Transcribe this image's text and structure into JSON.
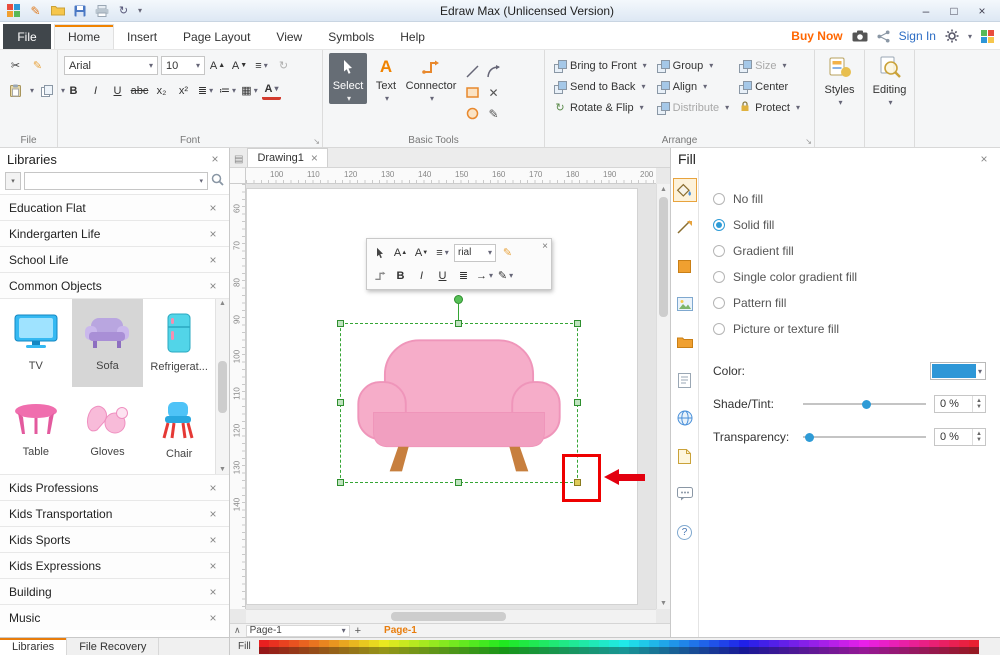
{
  "titlebar": {
    "title": "Edraw Max (Unlicensed Version)"
  },
  "menu": {
    "file": "File",
    "tabs": [
      "Home",
      "Insert",
      "Page Layout",
      "View",
      "Symbols",
      "Help"
    ],
    "buy_now": "Buy Now",
    "sign_in": "Sign In"
  },
  "ribbon": {
    "file_group": {
      "label": "File"
    },
    "font_group": {
      "label": "Font",
      "font_family": "Arial",
      "font_size": "10",
      "grow": "A",
      "shrink": "A",
      "bold": "B",
      "italic": "I",
      "underline": "U",
      "strike": "abc",
      "subscript": "x₂",
      "superscript": "x²",
      "color_letter": "A"
    },
    "basic_tools": {
      "label": "Basic Tools",
      "select": "Select",
      "text": "Text",
      "text_letter": "A",
      "connector": "Connector"
    },
    "arrange": {
      "label": "Arrange",
      "bring_to_front": "Bring to Front",
      "send_to_back": "Send to Back",
      "rotate_flip": "Rotate & Flip",
      "group": "Group",
      "align": "Align",
      "distribute": "Distribute",
      "size": "Size",
      "center": "Center",
      "protect": "Protect"
    },
    "styles": {
      "label": "Styles"
    },
    "editing": {
      "label": "Editing"
    }
  },
  "libraries_panel": {
    "title": "Libraries",
    "top_items": [
      "Education Flat",
      "Kindergarten Life",
      "School Life",
      "Common Objects"
    ],
    "symbols": [
      "TV",
      "Sofa",
      "Refrigerat...",
      "Table",
      "Gloves",
      "Chair"
    ],
    "selected_symbol": "Sofa",
    "bottom_items": [
      "Kids Professions",
      "Kids Transportation",
      "Kids Sports",
      "Kids Expressions",
      "Building",
      "Music"
    ],
    "footer_tabs": [
      "Libraries",
      "File Recovery"
    ]
  },
  "canvas": {
    "doc_tab": "Drawing1",
    "ruler_h": [
      "100",
      "110",
      "120",
      "130",
      "140",
      "150",
      "160",
      "170",
      "180",
      "190",
      "200"
    ],
    "ruler_v": [
      "60",
      "70",
      "80",
      "90",
      "100",
      "110",
      "120",
      "130",
      "140"
    ],
    "page_selector": "Page-1",
    "active_page": "Page-1",
    "floating_toolbar": {
      "font_value": "rial",
      "bold": "B",
      "italic": "I",
      "underline": "U",
      "grow": "A",
      "shrink": "A"
    }
  },
  "fill_panel": {
    "title": "Fill",
    "options": [
      "No fill",
      "Solid fill",
      "Gradient fill",
      "Single color gradient fill",
      "Pattern fill",
      "Picture or texture fill"
    ],
    "selected_option": "Solid fill",
    "color_label": "Color:",
    "accent_color": "#2e97d7",
    "shade_label": "Shade/Tint:",
    "shade_value": "0 %",
    "transparency_label": "Transparency:",
    "transparency_value": "0 %"
  },
  "status": {
    "fill_label": "Fill"
  },
  "palette_hues": [
    0,
    5,
    10,
    15,
    20,
    25,
    30,
    35,
    40,
    45,
    50,
    55,
    60,
    65,
    70,
    75,
    80,
    85,
    90,
    95,
    100,
    105,
    110,
    115,
    120,
    125,
    130,
    135,
    140,
    145,
    150,
    155,
    160,
    165,
    170,
    175,
    180,
    185,
    190,
    195,
    200,
    205,
    210,
    215,
    220,
    225,
    230,
    235,
    240,
    245,
    250,
    255,
    260,
    265,
    270,
    275,
    280,
    285,
    290,
    295,
    300,
    305,
    310,
    315,
    320,
    325,
    330,
    335,
    340,
    345,
    350,
    355
  ]
}
